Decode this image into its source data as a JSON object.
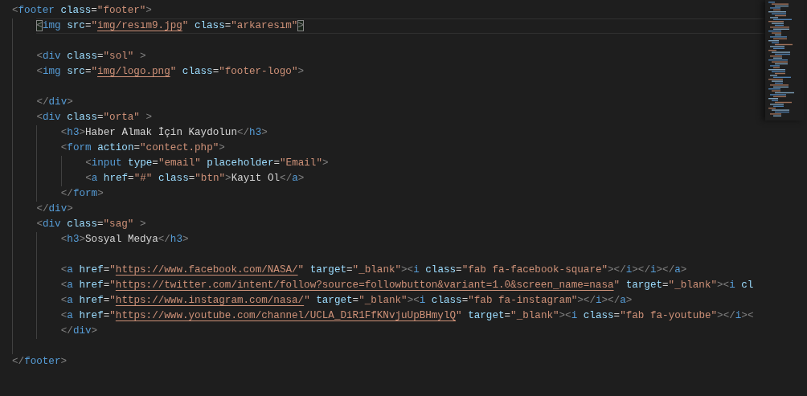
{
  "lines": [
    {
      "kind": "code",
      "current": false,
      "tokens": [
        {
          "kind": "punct",
          "text": "<"
        },
        {
          "kind": "tag",
          "text": "footer"
        },
        {
          "kind": "attr",
          "text": " class"
        },
        {
          "kind": "plain",
          "text": "="
        },
        {
          "kind": "string",
          "text": "\"footer\""
        },
        {
          "kind": "punct",
          "text": ">"
        }
      ],
      "children": [
        {
          "kind": "code",
          "current": true,
          "tokens": [
            {
              "kind": "bracket-match",
              "text": "<"
            },
            {
              "kind": "tag",
              "text": "img"
            },
            {
              "kind": "attr",
              "text": " src"
            },
            {
              "kind": "plain",
              "text": "="
            },
            {
              "kind": "string",
              "text": "\""
            },
            {
              "kind": "link",
              "text": "img/resım9.jpg"
            },
            {
              "kind": "string",
              "text": "\""
            },
            {
              "kind": "attr",
              "text": " class"
            },
            {
              "kind": "plain",
              "text": "="
            },
            {
              "kind": "string",
              "text": "\"arkaresım\""
            },
            {
              "kind": "bracket-match",
              "text": ">"
            }
          ]
        },
        {
          "kind": "blank",
          "current": false
        },
        {
          "kind": "code",
          "current": false,
          "tokens": [
            {
              "kind": "punct",
              "text": "<"
            },
            {
              "kind": "tag",
              "text": "div"
            },
            {
              "kind": "attr",
              "text": " class"
            },
            {
              "kind": "plain",
              "text": "="
            },
            {
              "kind": "string",
              "text": "\"sol\""
            },
            {
              "kind": "punct",
              "text": " >"
            }
          ]
        },
        {
          "kind": "code",
          "current": false,
          "tokens": [
            {
              "kind": "punct",
              "text": "<"
            },
            {
              "kind": "tag",
              "text": "img"
            },
            {
              "kind": "attr",
              "text": " src"
            },
            {
              "kind": "plain",
              "text": "="
            },
            {
              "kind": "string",
              "text": "\""
            },
            {
              "kind": "link",
              "text": "img/logo.png"
            },
            {
              "kind": "string",
              "text": "\""
            },
            {
              "kind": "attr",
              "text": " class"
            },
            {
              "kind": "plain",
              "text": "="
            },
            {
              "kind": "string",
              "text": "\"footer-logo\""
            },
            {
              "kind": "punct",
              "text": ">"
            }
          ]
        },
        {
          "kind": "blank",
          "current": false
        },
        {
          "kind": "code",
          "current": false,
          "tokens": [
            {
              "kind": "punct",
              "text": "</"
            },
            {
              "kind": "tag",
              "text": "div"
            },
            {
              "kind": "punct",
              "text": ">"
            }
          ]
        },
        {
          "kind": "code",
          "current": false,
          "tokens": [
            {
              "kind": "punct",
              "text": "<"
            },
            {
              "kind": "tag",
              "text": "div"
            },
            {
              "kind": "attr",
              "text": " class"
            },
            {
              "kind": "plain",
              "text": "="
            },
            {
              "kind": "string",
              "text": "\"orta\""
            },
            {
              "kind": "punct",
              "text": " >"
            }
          ],
          "children": [
            {
              "kind": "code",
              "current": false,
              "tokens": [
                {
                  "kind": "punct",
                  "text": "<"
                },
                {
                  "kind": "tag",
                  "text": "h3"
                },
                {
                  "kind": "punct",
                  "text": ">"
                },
                {
                  "kind": "plain",
                  "text": "Haber Almak İçin Kaydolun"
                },
                {
                  "kind": "punct",
                  "text": "</"
                },
                {
                  "kind": "tag",
                  "text": "h3"
                },
                {
                  "kind": "punct",
                  "text": ">"
                }
              ]
            },
            {
              "kind": "code",
              "current": false,
              "tokens": [
                {
                  "kind": "punct",
                  "text": "<"
                },
                {
                  "kind": "tag",
                  "text": "form"
                },
                {
                  "kind": "attr",
                  "text": " action"
                },
                {
                  "kind": "plain",
                  "text": "="
                },
                {
                  "kind": "string",
                  "text": "\"contect.php\""
                },
                {
                  "kind": "punct",
                  "text": ">"
                }
              ],
              "children": [
                {
                  "kind": "code",
                  "current": false,
                  "tokens": [
                    {
                      "kind": "punct",
                      "text": "<"
                    },
                    {
                      "kind": "tag",
                      "text": "input"
                    },
                    {
                      "kind": "attr",
                      "text": " type"
                    },
                    {
                      "kind": "plain",
                      "text": "="
                    },
                    {
                      "kind": "string",
                      "text": "\"email\""
                    },
                    {
                      "kind": "attr",
                      "text": " placeholder"
                    },
                    {
                      "kind": "plain",
                      "text": "="
                    },
                    {
                      "kind": "string",
                      "text": "\"Email\""
                    },
                    {
                      "kind": "punct",
                      "text": ">"
                    }
                  ]
                },
                {
                  "kind": "code",
                  "current": false,
                  "tokens": [
                    {
                      "kind": "punct",
                      "text": "<"
                    },
                    {
                      "kind": "tag",
                      "text": "a"
                    },
                    {
                      "kind": "attr",
                      "text": " href"
                    },
                    {
                      "kind": "plain",
                      "text": "="
                    },
                    {
                      "kind": "string",
                      "text": "\"#\""
                    },
                    {
                      "kind": "attr",
                      "text": " class"
                    },
                    {
                      "kind": "plain",
                      "text": "="
                    },
                    {
                      "kind": "string",
                      "text": "\"btn\""
                    },
                    {
                      "kind": "punct",
                      "text": ">"
                    },
                    {
                      "kind": "plain",
                      "text": "Kayıt Ol"
                    },
                    {
                      "kind": "punct",
                      "text": "</"
                    },
                    {
                      "kind": "tag",
                      "text": "a"
                    },
                    {
                      "kind": "punct",
                      "text": ">"
                    }
                  ]
                }
              ]
            },
            {
              "kind": "code",
              "current": false,
              "tokens": [
                {
                  "kind": "punct",
                  "text": "</"
                },
                {
                  "kind": "tag",
                  "text": "form"
                },
                {
                  "kind": "punct",
                  "text": ">"
                }
              ]
            }
          ]
        },
        {
          "kind": "code",
          "current": false,
          "tokens": [
            {
              "kind": "punct",
              "text": "</"
            },
            {
              "kind": "tag",
              "text": "div"
            },
            {
              "kind": "punct",
              "text": ">"
            }
          ]
        },
        {
          "kind": "code",
          "current": false,
          "tokens": [
            {
              "kind": "punct",
              "text": "<"
            },
            {
              "kind": "tag",
              "text": "div"
            },
            {
              "kind": "attr",
              "text": " class"
            },
            {
              "kind": "plain",
              "text": "="
            },
            {
              "kind": "string",
              "text": "\"sag\""
            },
            {
              "kind": "punct",
              "text": " >"
            }
          ],
          "children": [
            {
              "kind": "code",
              "current": false,
              "tokens": [
                {
                  "kind": "punct",
                  "text": "<"
                },
                {
                  "kind": "tag",
                  "text": "h3"
                },
                {
                  "kind": "punct",
                  "text": ">"
                },
                {
                  "kind": "plain",
                  "text": "Sosyal Medya"
                },
                {
                  "kind": "punct",
                  "text": "</"
                },
                {
                  "kind": "tag",
                  "text": "h3"
                },
                {
                  "kind": "punct",
                  "text": ">"
                }
              ]
            },
            {
              "kind": "blank",
              "current": false
            },
            {
              "kind": "code",
              "current": false,
              "tokens": [
                {
                  "kind": "punct",
                  "text": "<"
                },
                {
                  "kind": "tag",
                  "text": "a"
                },
                {
                  "kind": "attr",
                  "text": " href"
                },
                {
                  "kind": "plain",
                  "text": "="
                },
                {
                  "kind": "string",
                  "text": "\""
                },
                {
                  "kind": "link",
                  "text": "https://www.facebook.com/NASA/"
                },
                {
                  "kind": "string",
                  "text": "\""
                },
                {
                  "kind": "attr",
                  "text": " target"
                },
                {
                  "kind": "plain",
                  "text": "="
                },
                {
                  "kind": "string",
                  "text": "\"_blank\""
                },
                {
                  "kind": "punct",
                  "text": "><"
                },
                {
                  "kind": "tag",
                  "text": "i"
                },
                {
                  "kind": "attr",
                  "text": " class"
                },
                {
                  "kind": "plain",
                  "text": "="
                },
                {
                  "kind": "string",
                  "text": "\"fab fa-facebook-square\""
                },
                {
                  "kind": "punct",
                  "text": "></"
                },
                {
                  "kind": "tag",
                  "text": "i"
                },
                {
                  "kind": "punct",
                  "text": "></"
                },
                {
                  "kind": "tag",
                  "text": "i"
                },
                {
                  "kind": "punct",
                  "text": "></"
                },
                {
                  "kind": "tag",
                  "text": "a"
                },
                {
                  "kind": "punct",
                  "text": ">"
                }
              ]
            },
            {
              "kind": "code",
              "current": false,
              "tokens": [
                {
                  "kind": "punct",
                  "text": "<"
                },
                {
                  "kind": "tag",
                  "text": "a"
                },
                {
                  "kind": "attr",
                  "text": " href"
                },
                {
                  "kind": "plain",
                  "text": "="
                },
                {
                  "kind": "string",
                  "text": "\""
                },
                {
                  "kind": "link",
                  "text": "https://twitter.com/intent/follow?source=followbutton&variant=1.0&screen_name=nasa"
                },
                {
                  "kind": "string",
                  "text": "\""
                },
                {
                  "kind": "attr",
                  "text": " target"
                },
                {
                  "kind": "plain",
                  "text": "="
                },
                {
                  "kind": "string",
                  "text": "\"_blank\""
                },
                {
                  "kind": "punct",
                  "text": "><"
                },
                {
                  "kind": "tag",
                  "text": "i"
                },
                {
                  "kind": "attr",
                  "text": " cl"
                }
              ]
            },
            {
              "kind": "code",
              "current": false,
              "tokens": [
                {
                  "kind": "punct",
                  "text": "<"
                },
                {
                  "kind": "tag",
                  "text": "a"
                },
                {
                  "kind": "attr",
                  "text": " href"
                },
                {
                  "kind": "plain",
                  "text": "="
                },
                {
                  "kind": "string",
                  "text": "\""
                },
                {
                  "kind": "link",
                  "text": "https://www.instagram.com/nasa/"
                },
                {
                  "kind": "string",
                  "text": "\""
                },
                {
                  "kind": "attr",
                  "text": " target"
                },
                {
                  "kind": "plain",
                  "text": "="
                },
                {
                  "kind": "string",
                  "text": "\"_blank\""
                },
                {
                  "kind": "punct",
                  "text": "><"
                },
                {
                  "kind": "tag",
                  "text": "i"
                },
                {
                  "kind": "attr",
                  "text": " class"
                },
                {
                  "kind": "plain",
                  "text": "="
                },
                {
                  "kind": "string",
                  "text": "\"fab fa-instagram\""
                },
                {
                  "kind": "punct",
                  "text": "></"
                },
                {
                  "kind": "tag",
                  "text": "i"
                },
                {
                  "kind": "punct",
                  "text": "></"
                },
                {
                  "kind": "tag",
                  "text": "a"
                },
                {
                  "kind": "punct",
                  "text": ">"
                }
              ]
            },
            {
              "kind": "code",
              "current": false,
              "tokens": [
                {
                  "kind": "punct",
                  "text": "<"
                },
                {
                  "kind": "tag",
                  "text": "a"
                },
                {
                  "kind": "attr",
                  "text": " href"
                },
                {
                  "kind": "plain",
                  "text": "="
                },
                {
                  "kind": "string",
                  "text": "\""
                },
                {
                  "kind": "link",
                  "text": "https://www.youtube.com/channel/UCLA_DiR1FfKNvjuUpBHmylQ"
                },
                {
                  "kind": "string",
                  "text": "\""
                },
                {
                  "kind": "attr",
                  "text": " target"
                },
                {
                  "kind": "plain",
                  "text": "="
                },
                {
                  "kind": "string",
                  "text": "\"_blank\""
                },
                {
                  "kind": "punct",
                  "text": "><"
                },
                {
                  "kind": "tag",
                  "text": "i"
                },
                {
                  "kind": "attr",
                  "text": " class"
                },
                {
                  "kind": "plain",
                  "text": "="
                },
                {
                  "kind": "string",
                  "text": "\"fab fa-youtube\""
                },
                {
                  "kind": "punct",
                  "text": "></"
                },
                {
                  "kind": "tag",
                  "text": "i"
                },
                {
                  "kind": "punct",
                  "text": "><"
                }
              ]
            },
            {
              "kind": "code",
              "current": false,
              "tokens": [
                {
                  "kind": "punct",
                  "text": "</"
                },
                {
                  "kind": "tag",
                  "text": "div"
                },
                {
                  "kind": "punct",
                  "text": ">"
                }
              ]
            }
          ]
        },
        {
          "kind": "blank",
          "current": false
        }
      ]
    },
    {
      "kind": "code",
      "current": false,
      "tokens": [
        {
          "kind": "punct",
          "text": "</"
        },
        {
          "kind": "tag",
          "text": "footer"
        },
        {
          "kind": "punct",
          "text": ">"
        }
      ]
    }
  ]
}
